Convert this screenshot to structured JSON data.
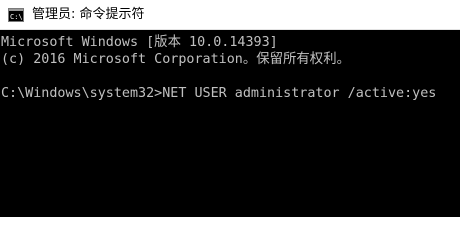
{
  "window": {
    "title": "管理员: 命令提示符",
    "icon": "command-prompt-icon"
  },
  "console": {
    "lines": [
      "Microsoft Windows [版本 10.0.14393]",
      "(c) 2016 Microsoft Corporation。保留所有权利。",
      "",
      "C:\\Windows\\system32>NET USER administrator /active:yes"
    ]
  },
  "colors": {
    "console_background": "#000000",
    "console_text": "#c0c0c0",
    "titlebar_background": "#ffffff"
  }
}
